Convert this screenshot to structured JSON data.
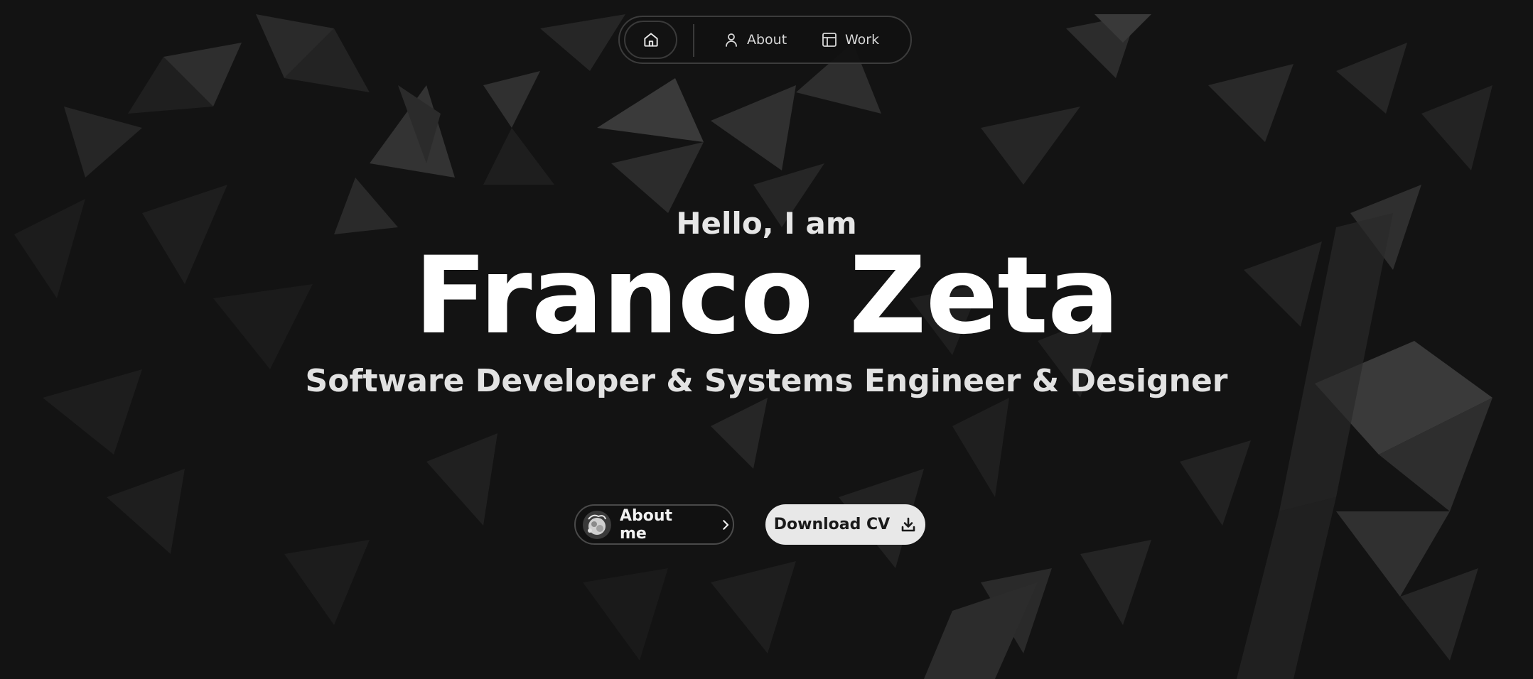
{
  "nav": {
    "home_icon": "home-icon",
    "items": [
      {
        "label": "About",
        "icon": "user-icon"
      },
      {
        "label": "Work",
        "icon": "layout-icon"
      }
    ]
  },
  "hero": {
    "greeting": "Hello, I am",
    "name": "Franco Zeta",
    "subtitle": "Software Developer & Systems Engineer & Designer"
  },
  "buttons": {
    "about_me": {
      "label": "About me",
      "icon": "chevron-right-icon"
    },
    "download_cv": {
      "label": "Download CV",
      "icon": "download-icon"
    }
  },
  "colors": {
    "background": "#131313",
    "text_primary": "#ffffff",
    "cv_button_bg": "#e8e8e8"
  }
}
